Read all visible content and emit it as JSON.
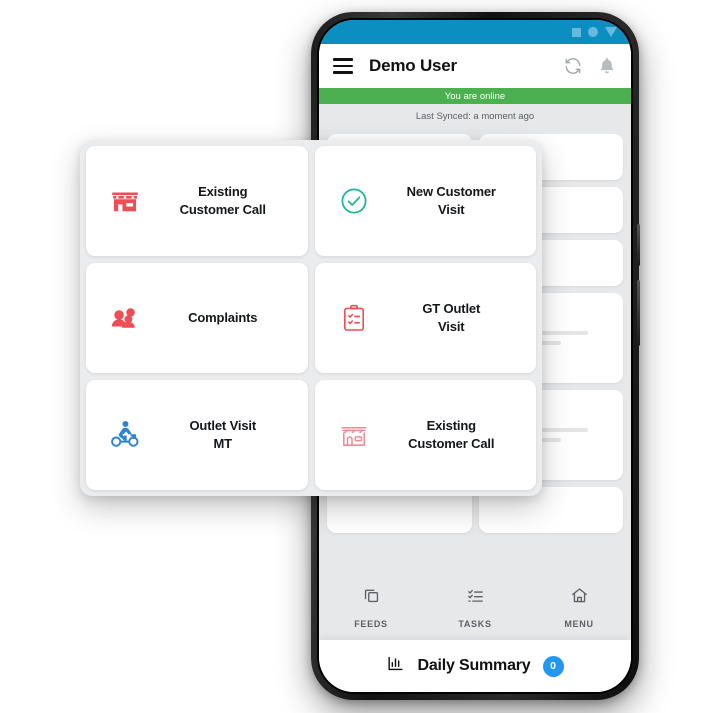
{
  "statusbar": {
    "icons": [
      "square-indicator",
      "circle-indicator",
      "triangle-indicator"
    ]
  },
  "appbar": {
    "menu_icon": "hamburger-menu-icon",
    "title": "Demo User",
    "sync_icon": "sync-refresh-icon",
    "notification_icon": "bell-icon"
  },
  "status": {
    "online_text": "You are online",
    "online_color": "#4caf50",
    "last_synced_text": "Last Synced: a moment ago"
  },
  "overlay": {
    "tiles": [
      {
        "label": "Existing\nCustomer Call",
        "icon": "store-front-solid-icon",
        "color": "#ef4d55"
      },
      {
        "label": "New Customer\nVisit",
        "icon": "check-circle-outline-icon",
        "color": "#18b895"
      },
      {
        "label": "Complaints",
        "icon": "people-group-icon",
        "color": "#ef4d55"
      },
      {
        "label": "GT Outlet\nVisit",
        "icon": "clipboard-checklist-icon",
        "color": "#ef4d55"
      },
      {
        "label": "Outlet Visit\nMT",
        "icon": "scooter-rider-icon",
        "color": "#2f84d0"
      },
      {
        "label": "Existing\nCustomer Call",
        "icon": "store-front-outline-icon",
        "color": "#f08b93"
      }
    ]
  },
  "bottom_nav": {
    "items": [
      {
        "label": "FEEDS",
        "icon": "copy-pages-icon"
      },
      {
        "label": "TASKS",
        "icon": "task-checklist-icon"
      },
      {
        "label": "MENU",
        "icon": "home-icon"
      }
    ]
  },
  "daily_summary": {
    "icon": "bar-chart-icon",
    "title": "Daily Summary",
    "badge": "0",
    "badge_color": "#2196f3"
  }
}
